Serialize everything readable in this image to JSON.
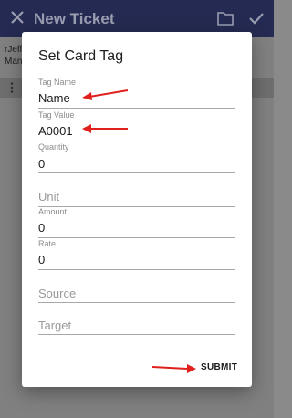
{
  "appbar": {
    "title": "New Ticket",
    "close_icon": "close-icon",
    "folder_icon": "folder-icon",
    "check_icon": "check-icon"
  },
  "background": {
    "line1": "rJeff",
    "line2": "Man"
  },
  "dialog": {
    "title": "Set Card Tag",
    "fields": {
      "tag_name": {
        "label": "Tag Name",
        "value": "Name"
      },
      "tag_value": {
        "label": "Tag Value",
        "value": "A0001"
      },
      "quantity": {
        "label": "Quantity",
        "value": "0"
      },
      "unit": {
        "placeholder": "Unit"
      },
      "amount": {
        "label": "Amount",
        "value": "0"
      },
      "rate": {
        "label": "Rate",
        "value": "0"
      },
      "source": {
        "placeholder": "Source"
      },
      "target": {
        "placeholder": "Target"
      }
    },
    "submit_label": "SUBMIT"
  },
  "colors": {
    "appbar": "#252a52",
    "annotation_arrow": "#e0201c"
  }
}
